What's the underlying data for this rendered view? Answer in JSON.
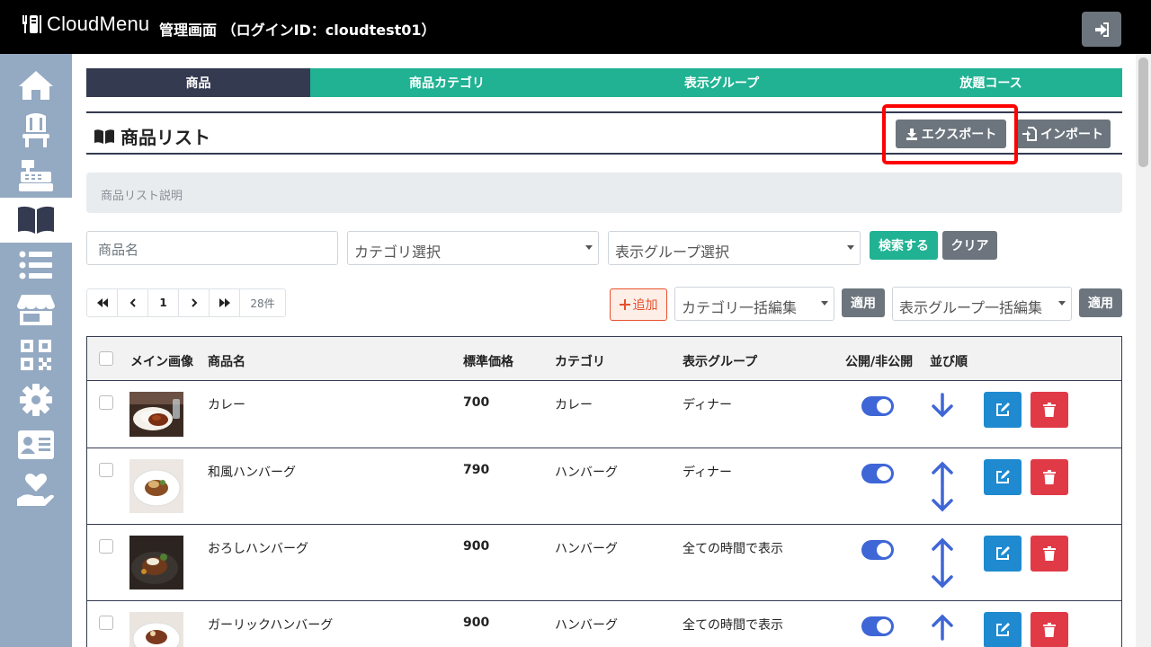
{
  "header": {
    "logo_text": "CloudMenu",
    "title": "管理画面 （ログインID：cloudtest01）",
    "logout_icon": "sign-out-icon"
  },
  "sidebar": {
    "items": [
      {
        "icon": "home-icon",
        "active": false
      },
      {
        "icon": "chair-icon",
        "active": false
      },
      {
        "icon": "cash-register-icon",
        "active": false
      },
      {
        "icon": "book-icon",
        "active": true
      },
      {
        "icon": "list-icon",
        "active": false
      },
      {
        "icon": "store-icon",
        "active": false
      },
      {
        "icon": "qrcode-icon",
        "active": false
      },
      {
        "icon": "gear-icon",
        "active": false
      },
      {
        "icon": "id-card-icon",
        "active": false
      },
      {
        "icon": "hand-heart-icon",
        "active": false
      }
    ]
  },
  "tabs": [
    {
      "label": "商品",
      "active": true
    },
    {
      "label": "商品カテゴリ",
      "active": false
    },
    {
      "label": "表示グループ",
      "active": false
    },
    {
      "label": "放題コース",
      "active": false
    }
  ],
  "section": {
    "title": "商品リスト",
    "export_label": "エクスポート",
    "import_label": "インポート",
    "description": "商品リスト説明"
  },
  "search": {
    "name_placeholder": "商品名",
    "category_select": "カテゴリ選択",
    "group_select": "表示グループ選択",
    "search_label": "検索する",
    "clear_label": "クリア"
  },
  "pager": {
    "first": "⏮",
    "prev": "‹",
    "page": "1",
    "next": "›",
    "last": "⏭",
    "count": "28件"
  },
  "bulk": {
    "add_label": "追加",
    "category_bulk": "カテゴリ一括編集",
    "apply1": "適用",
    "group_bulk": "表示グループ一括編集",
    "apply2": "適用"
  },
  "table": {
    "headers": {
      "image": "メイン画像",
      "name": "商品名",
      "price": "標準価格",
      "category": "カテゴリ",
      "group": "表示グループ",
      "public": "公開/非公開",
      "order": "並び順"
    },
    "rows": [
      {
        "name": "カレー",
        "price": "700",
        "category": "カレー",
        "group": "ディナー",
        "order": "down",
        "published": true
      },
      {
        "name": "和風ハンバーグ",
        "price": "790",
        "category": "ハンバーグ",
        "group": "ディナー",
        "order": "updown",
        "published": true
      },
      {
        "name": "おろしハンバーグ",
        "price": "900",
        "category": "ハンバーグ",
        "group": "全ての時間で表示",
        "order": "updown",
        "published": true
      },
      {
        "name": "ガーリックハンバーグ",
        "price": "900",
        "category": "ハンバーグ",
        "group": "全ての時間で表示",
        "order": "updown",
        "published": true
      }
    ]
  },
  "colors": {
    "teal": "#20b293",
    "navy": "#343a50",
    "sidebar": "#94a9c2",
    "toggle_blue": "#3f66d6",
    "edit_blue": "#1f8ad0",
    "delete_red": "#e03a47",
    "highlight": "#ff0000"
  }
}
